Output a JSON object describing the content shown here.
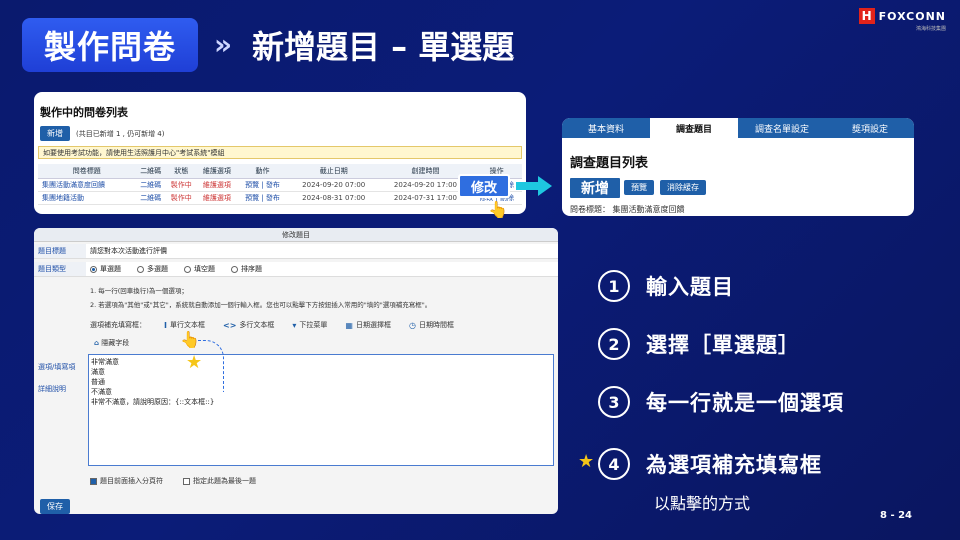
{
  "header": {
    "title": "製作問卷",
    "chevrons": "»",
    "subtitle": "新增題目 – 單選題",
    "logo_mark": "H",
    "logo_text": "FOXCONN",
    "logo_sub": "鴻海科技集團"
  },
  "list_panel": {
    "heading": "製作中的問卷列表",
    "add_label": "新增",
    "add_note": "(共目已新增 1 , 仍可新增 4)",
    "notice": "如要使用考試功能，請使用生活照護月中心\"考試系統\"模組",
    "columns": [
      "問卷標題",
      "二維碼",
      "狀態",
      "維護選項",
      "動作",
      "截止日期",
      "創建時間",
      "操作"
    ],
    "rows": [
      [
        "集團活動滿意度回饋",
        "二維碼",
        "製作中",
        "維護選項",
        "預覽 | 發布",
        "2024-09-20 07:00",
        "2024-09-20 17:00",
        "修改 | 刪除"
      ],
      [
        "集團地籍活動",
        "二維碼",
        "製作中",
        "維護選項",
        "預覽 | 發布",
        "2024-08-31 07:00",
        "2024-07-31 17:00",
        "修改 | 刪除"
      ]
    ],
    "edit_callout": "修改"
  },
  "item_panel": {
    "tabs": [
      "基本資料",
      "調查題目",
      "調查名單設定",
      "獎項設定"
    ],
    "active_tab": 1,
    "heading": "調查題目列表",
    "new_callout": "新增",
    "preview_label": "預覽",
    "clear_label": "消除緩存",
    "sub": "問卷標題： 集團活動滿意度回饋"
  },
  "edit_panel": {
    "bar": "修改題目",
    "title_label": "題目標題",
    "title_value": "請您對本次活動進行評價",
    "type_label": "題目類型",
    "types": [
      "單選題",
      "多選題",
      "填空題",
      "排序題"
    ],
    "selected_type": 0,
    "help1": "1. 每一行(回車換行)為一個選項；",
    "help2": "2. 若選項為\"其他\"或\"其它\"，系統就自動添加一個行輸入框。您也可以點擊下方按鈕插入常用的\"填的\"選項補充寫框\"。",
    "field_label": "選項補充填寫框：",
    "fields": [
      "單行文本框",
      "多行文本框",
      "下拉菜單",
      "日期選擇框",
      "日期時間框"
    ],
    "field_extra": "隱藏字段",
    "side1": "選項/填寫項",
    "side2": "詳細說明",
    "options_text": "非常滿意\n滿意\n普通\n不滿意\n非常不滿意，請說明原因：{::文本框::}",
    "check1": "題目前面插入分頁符",
    "check2": "指定此題為最後一題",
    "save_label": "保存"
  },
  "steps": [
    {
      "num": "1",
      "text": "輸入題目"
    },
    {
      "num": "2",
      "text": "選擇［單選題］"
    },
    {
      "num": "3",
      "text": "每一行就是一個選項"
    },
    {
      "num": "4",
      "text": "為選項補充填寫框"
    }
  ],
  "step4_note": "以點擊的方式",
  "page_number": "8 - 24",
  "star": "★"
}
